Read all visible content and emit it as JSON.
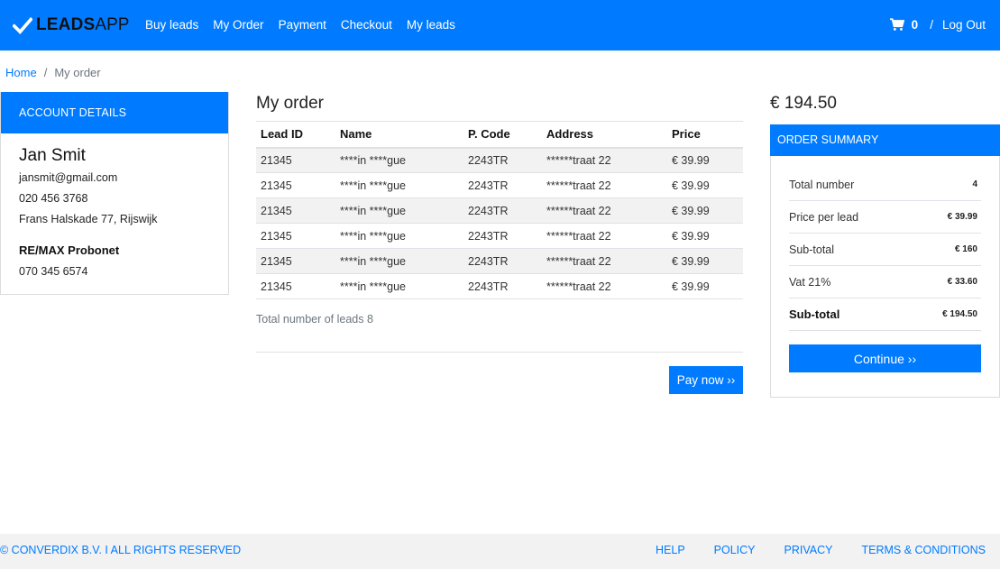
{
  "brand": {
    "bold": "LEADS",
    "light": "APP"
  },
  "nav": {
    "links": [
      "Buy leads",
      "My Order",
      "Payment",
      "Checkout",
      "My leads"
    ],
    "cart_count": "0",
    "separator": "/",
    "logout": "Log Out"
  },
  "breadcrumb": {
    "home": "Home",
    "sep": "/",
    "current": "My order"
  },
  "account": {
    "header": "ACCOUNT DETAILS",
    "name": "Jan Smit",
    "email": "jansmit@gmail.com",
    "phone": "020 456 3768",
    "address": "Frans Halskade 77, Rijswijk",
    "company": "RE/MAX Probonet",
    "company_phone": "070 345 6574"
  },
  "order": {
    "title": "My order",
    "columns": [
      "Lead ID",
      "Name",
      "P. Code",
      "Address",
      "Price"
    ],
    "rows": [
      [
        "21345",
        "****in ****gue",
        "2243TR",
        "******traat 22",
        "€ 39.99"
      ],
      [
        "21345",
        "****in ****gue",
        "2243TR",
        "******traat 22",
        "€ 39.99"
      ],
      [
        "21345",
        "****in ****gue",
        "2243TR",
        "******traat 22",
        "€ 39.99"
      ],
      [
        "21345",
        "****in ****gue",
        "2243TR",
        "******traat 22",
        "€ 39.99"
      ],
      [
        "21345",
        "****in ****gue",
        "2243TR",
        "******traat 22",
        "€ 39.99"
      ],
      [
        "21345",
        "****in ****gue",
        "2243TR",
        "******traat 22",
        "€ 39.99"
      ]
    ],
    "total_leads": "Total number of leads 8",
    "pay_button": "Pay now ››"
  },
  "summary": {
    "total_price": "€ 194.50",
    "header": "ORDER SUMMARY",
    "rows": [
      {
        "label": "Total number",
        "value": "4"
      },
      {
        "label": "Price per lead",
        "value": "€ 39.99"
      },
      {
        "label": "Sub-total",
        "value": "€ 160"
      },
      {
        "label": "Vat 21%",
        "value": "€ 33.60"
      },
      {
        "label": "Sub-total",
        "value": "€ 194.50"
      }
    ],
    "continue_button": "Continue ››"
  },
  "footer": {
    "copyright": "© CONVERDIX B.V. I ALL RIGHTS RESERVED",
    "links": [
      "HELP",
      "POLICY",
      "PRIVACY",
      "TERMS & CONDITIONS"
    ]
  },
  "colors": {
    "primary": "#007bff",
    "footer_bg": "#f2f2f2",
    "stripe": "#f2f2f2"
  },
  "icons": {
    "brand": "checkmark-icon",
    "cart": "shopping-cart-icon"
  }
}
